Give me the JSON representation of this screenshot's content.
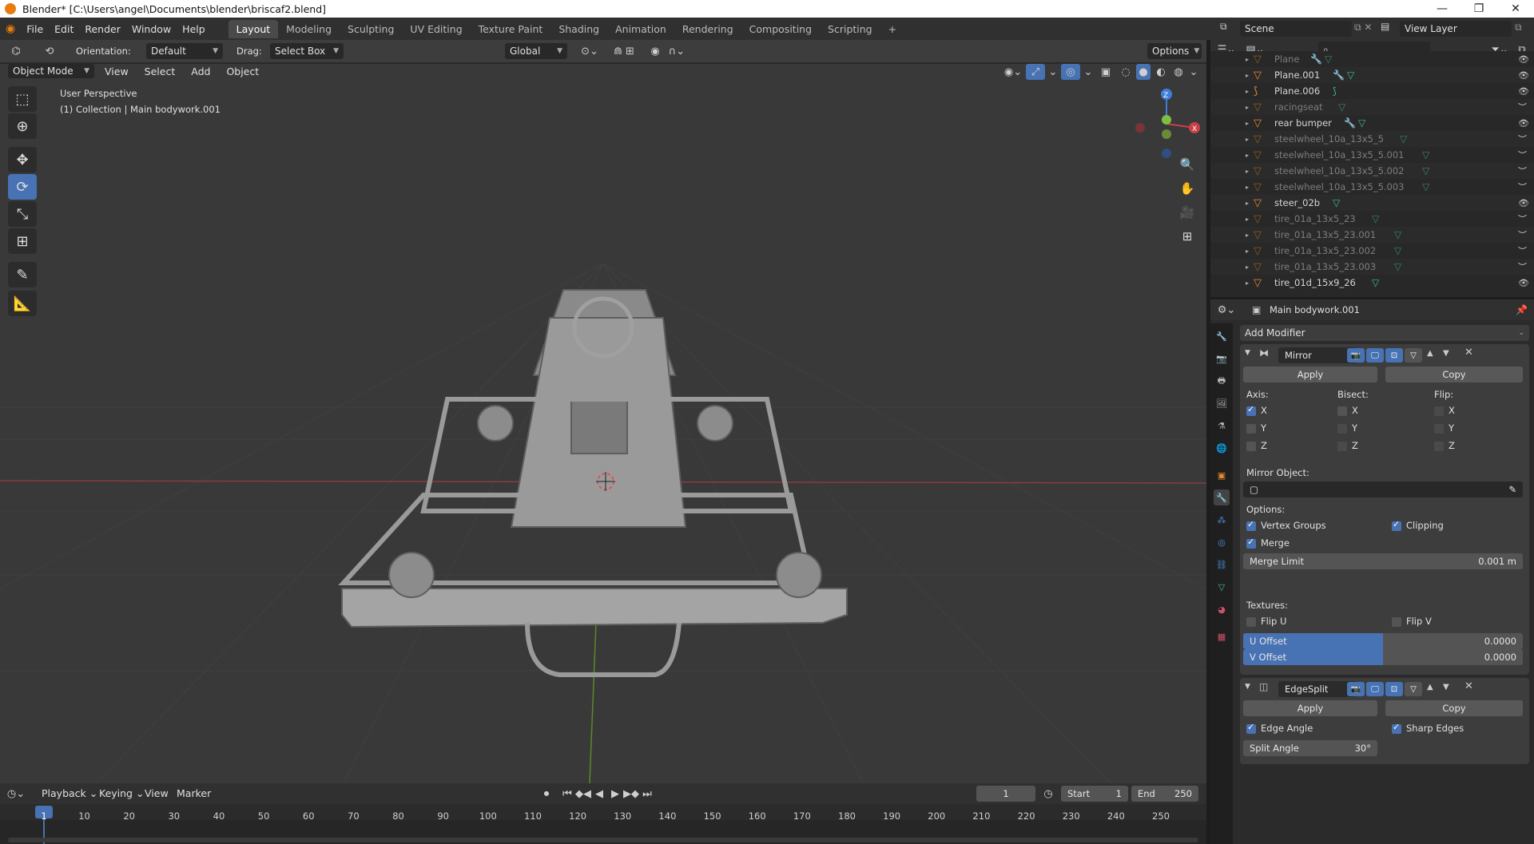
{
  "window": {
    "title": "Blender* [C:\\Users\\angel\\Documents\\blender\\briscaf2.blend]",
    "controls": [
      "—",
      "❐",
      "✕"
    ]
  },
  "menu": [
    "File",
    "Edit",
    "Render",
    "Window",
    "Help"
  ],
  "workspaces": [
    "Layout",
    "Modeling",
    "Sculpting",
    "UV Editing",
    "Texture Paint",
    "Shading",
    "Animation",
    "Rendering",
    "Compositing",
    "Scripting"
  ],
  "active_workspace": "Layout",
  "add_workspace": "+",
  "scene": {
    "label": "Scene",
    "view_layer": "View Layer"
  },
  "tool_header": {
    "orientation_label": "Orientation:",
    "orientation_value": "Default",
    "drag_label": "Drag:",
    "drag_value": "Select Box",
    "transform_orientation": "Global",
    "options": "Options"
  },
  "viewport_header": {
    "mode": "Object Mode",
    "menus": [
      "View",
      "Select",
      "Add",
      "Object"
    ]
  },
  "viewport": {
    "perspective": "User Perspective",
    "collection_info": "(1) Collection | Main bodywork.001",
    "gizmo_axes": [
      "Z",
      "Y",
      "X"
    ]
  },
  "outliner": {
    "search_placeholder": "",
    "items": [
      {
        "name": "Plane",
        "visible": true,
        "dim": true,
        "has_modifier": true
      },
      {
        "name": "Plane.001",
        "visible": true,
        "dim": false,
        "has_modifier": true
      },
      {
        "name": "Plane.006",
        "visible": true,
        "dim": false,
        "has_modifier": false,
        "curve": true
      },
      {
        "name": "racingseat",
        "visible": false,
        "dim": true,
        "has_modifier": false
      },
      {
        "name": "rear bumper",
        "visible": true,
        "dim": false,
        "has_modifier": true
      },
      {
        "name": "steelwheel_10a_13x5_5",
        "visible": false,
        "dim": true,
        "has_modifier": false
      },
      {
        "name": "steelwheel_10a_13x5_5.001",
        "visible": false,
        "dim": true,
        "has_modifier": false
      },
      {
        "name": "steelwheel_10a_13x5_5.002",
        "visible": false,
        "dim": true,
        "has_modifier": false
      },
      {
        "name": "steelwheel_10a_13x5_5.003",
        "visible": false,
        "dim": true,
        "has_modifier": false
      },
      {
        "name": "steer_02b",
        "visible": true,
        "dim": false,
        "has_modifier": false
      },
      {
        "name": "tire_01a_13x5_23",
        "visible": false,
        "dim": true,
        "has_modifier": false
      },
      {
        "name": "tire_01a_13x5_23.001",
        "visible": false,
        "dim": true,
        "has_modifier": false
      },
      {
        "name": "tire_01a_13x5_23.002",
        "visible": false,
        "dim": true,
        "has_modifier": false
      },
      {
        "name": "tire_01a_13x5_23.003",
        "visible": false,
        "dim": true,
        "has_modifier": false
      },
      {
        "name": "tire_01d_15x9_26",
        "visible": true,
        "dim": false,
        "has_modifier": false
      }
    ]
  },
  "properties": {
    "object_name": "Main bodywork.001",
    "add_modifier": "Add Modifier",
    "mirror": {
      "name": "Mirror",
      "apply": "Apply",
      "copy": "Copy",
      "axis_label": "Axis:",
      "bisect_label": "Bisect:",
      "flip_label": "Flip:",
      "axes": [
        "X",
        "Y",
        "Z"
      ],
      "axis_checked": [
        true,
        false,
        false
      ],
      "mirror_object_label": "Mirror Object:",
      "options_label": "Options:",
      "vertex_groups": "Vertex Groups",
      "vertex_groups_on": true,
      "clipping": "Clipping",
      "clipping_on": true,
      "merge": "Merge",
      "merge_on": true,
      "merge_limit_label": "Merge Limit",
      "merge_limit_value": "0.001 m",
      "textures_label": "Textures:",
      "flip_u": "Flip U",
      "flip_v": "Flip V",
      "u_offset_label": "U Offset",
      "u_offset_value": "0.0000",
      "v_offset_label": "V Offset",
      "v_offset_value": "0.0000"
    },
    "edgesplit": {
      "name": "EdgeSplit",
      "apply": "Apply",
      "copy": "Copy",
      "edge_angle": "Edge Angle",
      "edge_angle_on": true,
      "sharp_edges": "Sharp Edges",
      "sharp_edges_on": true,
      "split_angle_label": "Split Angle",
      "split_angle_value": "30°"
    }
  },
  "timeline": {
    "menus": [
      "Playback",
      "Keying",
      "View",
      "Marker"
    ],
    "current_frame": "1",
    "start_label": "Start",
    "start": "1",
    "end_label": "End",
    "end": "250",
    "ticks": [
      "1",
      "10",
      "20",
      "30",
      "40",
      "50",
      "60",
      "70",
      "80",
      "90",
      "100",
      "110",
      "120",
      "130",
      "140",
      "150",
      "160",
      "170",
      "180",
      "190",
      "200",
      "210",
      "220",
      "230",
      "240",
      "250"
    ]
  },
  "colors": {
    "accent": "#4772b3",
    "object_orange": "#e88a2f",
    "mesh_green": "#3fbf8f",
    "axis_red": "#c8404a",
    "axis_green": "#7fbf3f",
    "axis_blue": "#3f7fd8"
  }
}
